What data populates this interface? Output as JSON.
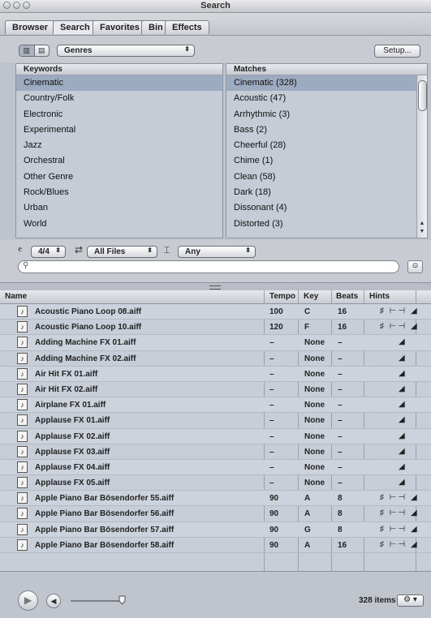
{
  "window": {
    "title": "Search"
  },
  "tabs": [
    "Browser",
    "Search",
    "Favorites",
    "Bin",
    "Effects"
  ],
  "toolbar": {
    "filter_mode": "Genres",
    "setup_label": "Setup..."
  },
  "keywords": {
    "header": "Keywords",
    "items": [
      "Cinematic",
      "Country/Folk",
      "Electronic",
      "Experimental",
      "Jazz",
      "Orchestral",
      "Other Genre",
      "Rock/Blues",
      "Urban",
      "World"
    ]
  },
  "matches": {
    "header": "Matches",
    "items": [
      "Cinematic (328)",
      "Acoustic (47)",
      "Arrhythmic (3)",
      "Bass (2)",
      "Cheerful (28)",
      "Chime (1)",
      "Clean (58)",
      "Dark (18)",
      "Dissonant (4)",
      "Distorted (3)"
    ]
  },
  "filters": {
    "time_signature": "4/4",
    "file_type": "All Files",
    "key_filter": "Any"
  },
  "search": {
    "placeholder": "",
    "value": ""
  },
  "table": {
    "headers": {
      "name": "Name",
      "tempo": "Tempo",
      "key": "Key",
      "beats": "Beats",
      "hints": "Hints"
    },
    "rows": [
      {
        "name": "Acoustic Piano Loop 08.aiff",
        "tempo": "100",
        "key": "C",
        "beats": "16",
        "hints": "full"
      },
      {
        "name": "Acoustic Piano Loop 10.aiff",
        "tempo": "120",
        "key": "F",
        "beats": "16",
        "hints": "full"
      },
      {
        "name": "Adding Machine FX 01.aiff",
        "tempo": "–",
        "key": "None",
        "beats": "–",
        "hints": "one"
      },
      {
        "name": "Adding Machine FX 02.aiff",
        "tempo": "–",
        "key": "None",
        "beats": "–",
        "hints": "one"
      },
      {
        "name": "Air Hit FX 01.aiff",
        "tempo": "–",
        "key": "None",
        "beats": "–",
        "hints": "one"
      },
      {
        "name": "Air Hit FX 02.aiff",
        "tempo": "–",
        "key": "None",
        "beats": "–",
        "hints": "one"
      },
      {
        "name": "Airplane FX 01.aiff",
        "tempo": "–",
        "key": "None",
        "beats": "–",
        "hints": "one"
      },
      {
        "name": "Applause FX 01.aiff",
        "tempo": "–",
        "key": "None",
        "beats": "–",
        "hints": "one"
      },
      {
        "name": "Applause FX 02.aiff",
        "tempo": "–",
        "key": "None",
        "beats": "–",
        "hints": "one"
      },
      {
        "name": "Applause FX 03.aiff",
        "tempo": "–",
        "key": "None",
        "beats": "–",
        "hints": "one"
      },
      {
        "name": "Applause FX 04.aiff",
        "tempo": "–",
        "key": "None",
        "beats": "–",
        "hints": "one"
      },
      {
        "name": "Applause FX 05.aiff",
        "tempo": "–",
        "key": "None",
        "beats": "–",
        "hints": "one"
      },
      {
        "name": "Apple Piano Bar Bösendorfer 55.aiff",
        "tempo": "90",
        "key": "A",
        "beats": "8",
        "hints": "full"
      },
      {
        "name": "Apple Piano Bar Bösendorfer 56.aiff",
        "tempo": "90",
        "key": "A",
        "beats": "8",
        "hints": "full"
      },
      {
        "name": "Apple Piano Bar Bösendorfer 57.aiff",
        "tempo": "90",
        "key": "G",
        "beats": "8",
        "hints": "full"
      },
      {
        "name": "Apple Piano Bar Bösendorfer 58.aiff",
        "tempo": "90",
        "key": "A",
        "beats": "16",
        "hints": "full"
      }
    ]
  },
  "footer": {
    "item_count": "328 items"
  }
}
